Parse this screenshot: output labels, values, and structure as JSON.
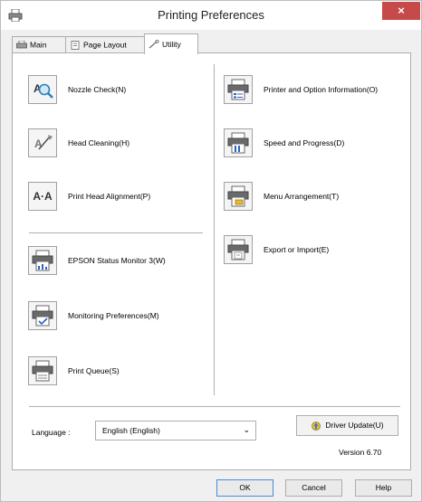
{
  "window": {
    "title": "Printing Preferences",
    "close_label": "×"
  },
  "tabs": [
    {
      "label": "Main",
      "icon": "printer-icon"
    },
    {
      "label": "Page Layout",
      "icon": "page-layout-icon"
    },
    {
      "label": "Utility",
      "icon": "wrench-icon"
    }
  ],
  "tools_left": [
    {
      "label": "Nozzle Check(N)",
      "icon": "nozzle-check-icon"
    },
    {
      "label": "Head Cleaning(H)",
      "icon": "head-cleaning-icon"
    },
    {
      "label": "Print Head Alignment(P)",
      "icon": "head-alignment-icon",
      "icon_text": "A·A"
    },
    {
      "label": "EPSON Status Monitor 3(W)",
      "icon": "status-monitor-icon"
    },
    {
      "label": "Monitoring Preferences(M)",
      "icon": "monitoring-preferences-icon"
    },
    {
      "label": "Print Queue(S)",
      "icon": "print-queue-icon"
    }
  ],
  "tools_right": [
    {
      "label": "Printer and Option Information(O)",
      "icon": "printer-info-icon"
    },
    {
      "label": "Speed and Progress(D)",
      "icon": "speed-progress-icon"
    },
    {
      "label": "Menu Arrangement(T)",
      "icon": "menu-arrangement-icon"
    },
    {
      "label": "Export or Import(E)",
      "icon": "export-import-icon"
    }
  ],
  "language": {
    "label": "Language :",
    "value": "English (English)"
  },
  "driver_update": {
    "label": "Driver Update(U)",
    "icon": "driver-update-icon"
  },
  "version": "Version 6.70",
  "footer": {
    "ok": "OK",
    "cancel": "Cancel",
    "help": "Help"
  },
  "colors": {
    "close": "#c74a4a",
    "accent": "#4a8ad8",
    "panel_bg": "#ffffff"
  }
}
